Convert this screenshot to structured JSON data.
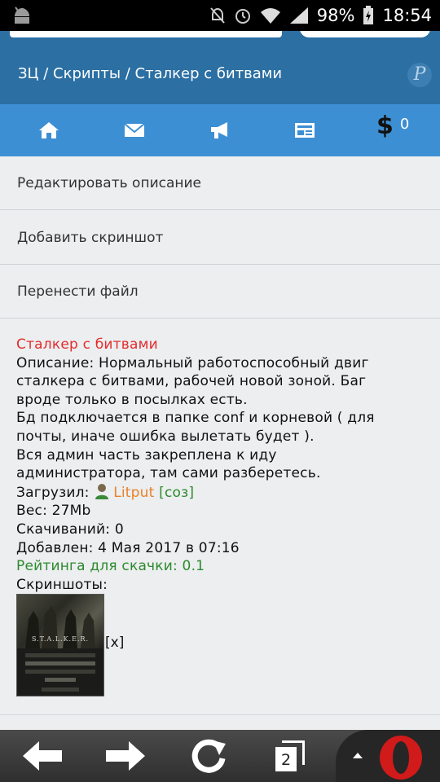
{
  "status_bar": {
    "battery": "98%",
    "time": "18:54"
  },
  "header": {
    "breadcrumb": "ЗЦ / Скрипты / Сталкер с битвами",
    "badge": "P"
  },
  "nav": {
    "items": [
      "home-icon",
      "mail-icon",
      "megaphone-icon",
      "news-icon"
    ],
    "coin_symbol": "$",
    "coin_count": "0"
  },
  "menu": {
    "items": [
      {
        "label": "Редактировать описание"
      },
      {
        "label": "Добавить скриншот"
      },
      {
        "label": "Перенести файл"
      }
    ]
  },
  "file": {
    "title": "Сталкер с битвами",
    "description_lines": [
      "Описание: Нормальный работоспособный двиг",
      "сталкера с битвами, рабочей новой зоной. Баг",
      "вроде только в посылках есть.",
      "Бд подключается в папке conf и корневой ( для",
      "почты, иначе ошибка вылетать будет ).",
      "Вся админ часть закреплена к иду",
      "администратора, там сами разберетесь."
    ],
    "uploader_label": "Загрузил:",
    "uploader_name": "Litput",
    "uploader_tag": "[соз]",
    "size": "Вес: 27Mb",
    "downloads": "Скачиваний: 0",
    "added": "Добавлен: 4 Мая 2017 в 07:16",
    "rating": "Рейтинга для скачки: 0.1",
    "screenshots_label": "Скриншоты:",
    "screenshot_logo": "S.T.A.L.K.E.R.",
    "remove_label": "[x]"
  },
  "browser": {
    "tabs_count": "2",
    "buttons": [
      "back-arrow-icon",
      "forward-arrow-icon",
      "reload-icon",
      "tabs-icon",
      "opera-menu-icon"
    ]
  }
}
